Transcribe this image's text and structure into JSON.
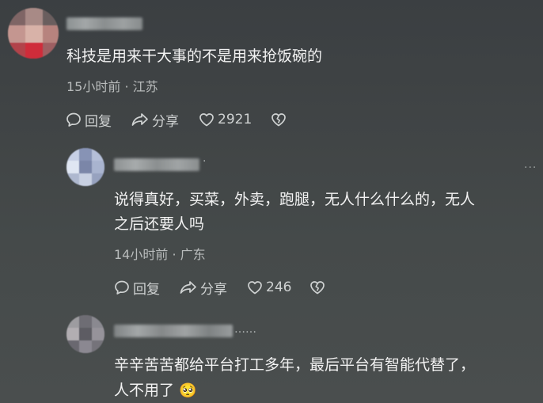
{
  "comments": [
    {
      "text": "科技是用来干大事的不是用来抢饭碗的",
      "meta": "15小时前 · 江苏",
      "reply_label": "回复",
      "share_label": "分享",
      "like_count": "2921"
    },
    {
      "text_line1": "说得真好，买菜，外卖，跑腿，无人什么什么的，无人",
      "text_line2": "之后还要人吗",
      "meta": "14小时前 · 广东",
      "reply_label": "回复",
      "share_label": "分享",
      "like_count": "246",
      "more": "···"
    },
    {
      "username_tail": "……",
      "text_line1": "辛辛苦苦都给平台打工多年，最后平台有智能代替了，",
      "text_line2": "人不用了",
      "emoji": "🥺"
    }
  ],
  "icons": {
    "reply": "reply-bubble-icon",
    "share": "share-arrow-icon",
    "like": "heart-icon",
    "dislike": "broken-heart-icon",
    "more": "more-dots-icon"
  }
}
